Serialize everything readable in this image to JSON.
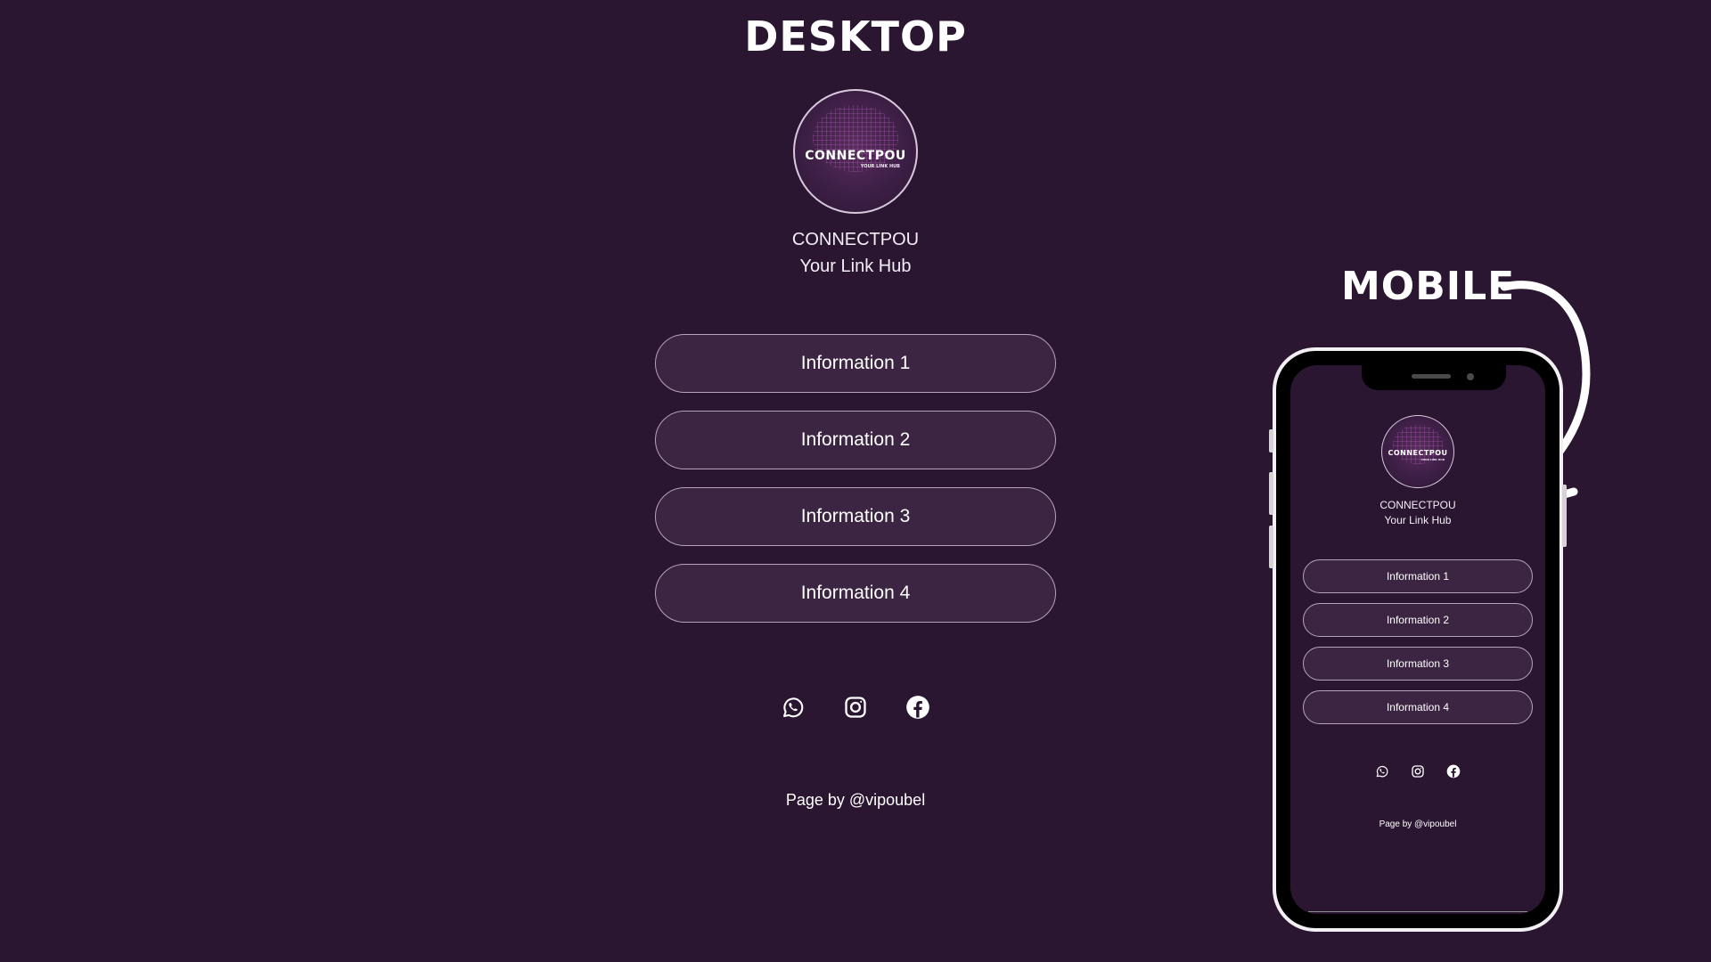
{
  "desktop": {
    "heading": "DESKTOP",
    "profile": {
      "logo_title": "CONNECTPOU",
      "logo_subtitle": "YOUR LINK HUB",
      "name": "CONNECTPOU",
      "tagline": "Your Link Hub"
    },
    "buttons": [
      {
        "label": "Information 1"
      },
      {
        "label": "Information 2"
      },
      {
        "label": "Information 3"
      },
      {
        "label": "Information 4"
      }
    ],
    "social_icons": [
      "whatsapp-icon",
      "instagram-icon",
      "facebook-icon"
    ],
    "footer": "Page by @vipoubel"
  },
  "mobile": {
    "heading": "MOBILE",
    "profile": {
      "logo_title": "CONNECTPOU",
      "logo_subtitle": "YOUR LINK HUB",
      "name": "CONNECTPOU",
      "tagline": "Your Link Hub"
    },
    "buttons": [
      {
        "label": "Information 1"
      },
      {
        "label": "Information 2"
      },
      {
        "label": "Information 3"
      },
      {
        "label": "Information 4"
      }
    ],
    "social_icons": [
      "whatsapp-icon",
      "instagram-icon",
      "facebook-icon"
    ],
    "footer": "Page by @vipoubel"
  },
  "colors": {
    "background": "#2a1630",
    "button_fill": "#3b2542",
    "button_border": "#b6a3bb",
    "text": "#ffffff",
    "phone_frame": "#000000"
  }
}
